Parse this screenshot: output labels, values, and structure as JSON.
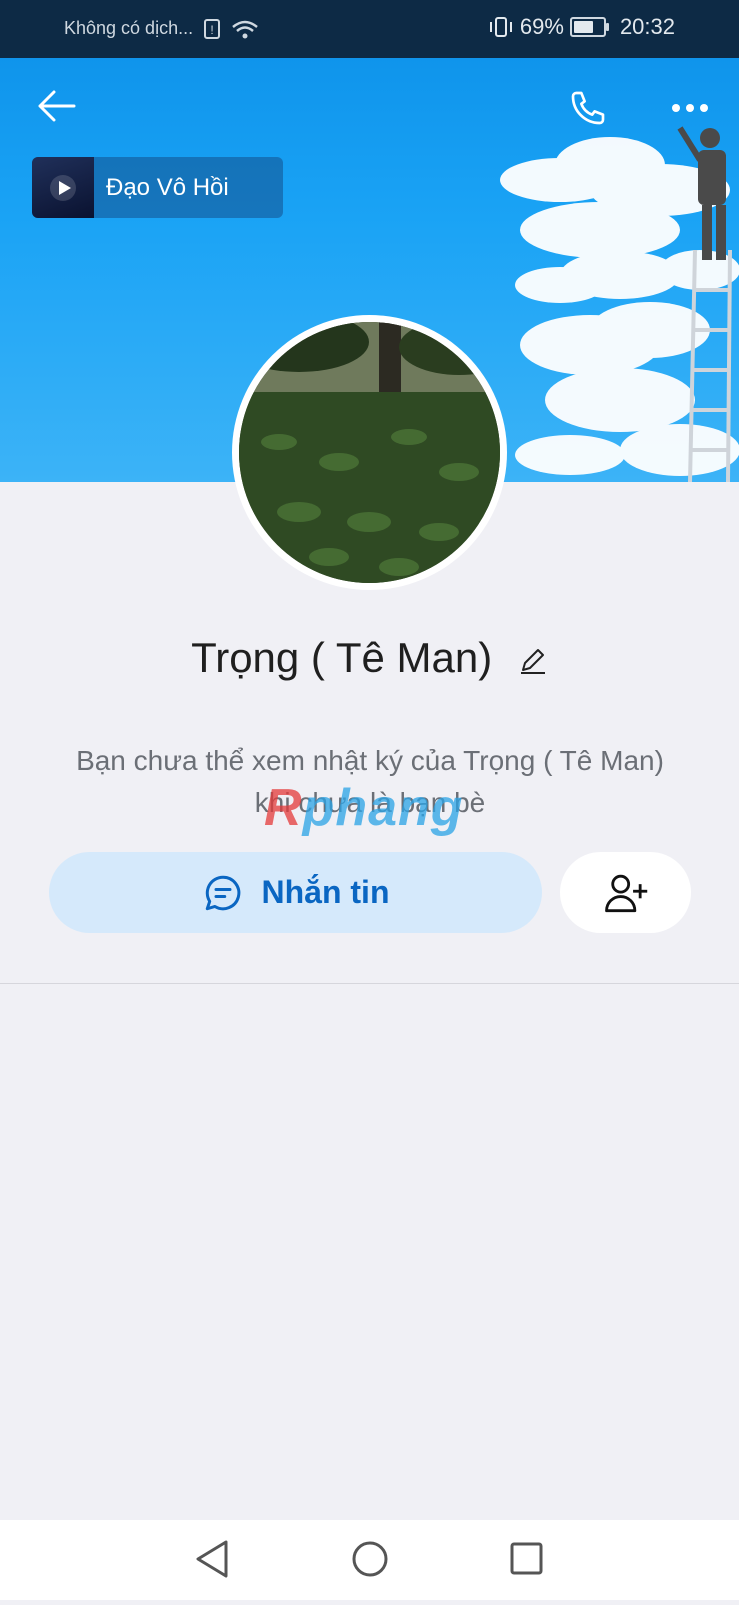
{
  "status_bar": {
    "carrier": "Không có dịch...",
    "battery": "69%",
    "battery_level": 0.69,
    "time": "20:32"
  },
  "header": {
    "back_icon": "arrow-left-icon",
    "call_icon": "phone-icon",
    "more_icon": "more-horizontal-icon"
  },
  "music": {
    "title": "Đạo Vô Hồi"
  },
  "profile": {
    "name": "Trọng ( Tê Man)",
    "edit_icon": "pencil-icon",
    "notice": "Bạn chưa thể xem nhật ký của Trọng ( Tê Man) khi chưa là bạn bè"
  },
  "actions": {
    "message_label": "Nhắn tin",
    "message_icon": "chat-bubble-icon",
    "add_friend_icon": "add-user-icon"
  },
  "watermark": {
    "first": "R",
    "rest": "phang"
  },
  "nav": {
    "back": "triangle-back-icon",
    "home": "circle-home-icon",
    "recents": "square-recents-icon"
  },
  "colors": {
    "accent": "#0a66c2",
    "cover_sky": "#1aa3f5",
    "message_button_bg": "#d5e9fb"
  }
}
